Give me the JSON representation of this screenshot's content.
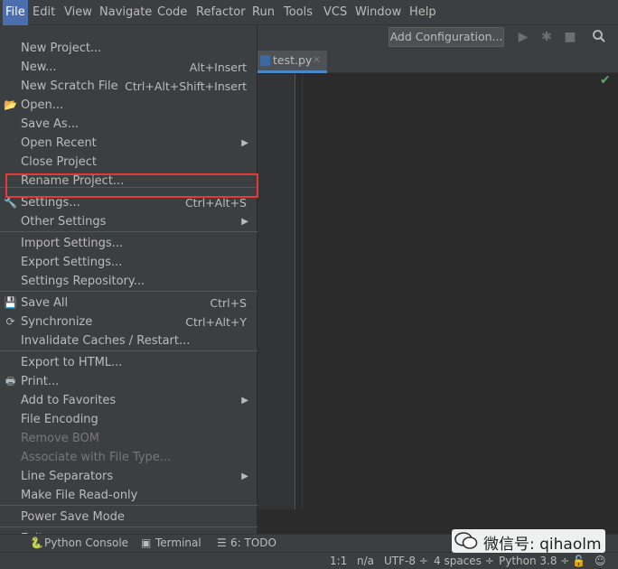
{
  "menubar": {
    "items": [
      "File",
      "Edit",
      "View",
      "Navigate",
      "Code",
      "Refactor",
      "Run",
      "Tools",
      "VCS",
      "Window",
      "Help"
    ],
    "active": "File"
  },
  "toolbar": {
    "add_configuration": "Add Configuration...",
    "icons": [
      "run-icon",
      "debug-icon",
      "stop-icon",
      "search-icon"
    ]
  },
  "editor": {
    "tab_label": "test.py",
    "tab_close": "×",
    "inspection": "check-icon"
  },
  "file_menu": {
    "items": [
      {
        "label": "New Project...",
        "shortcut": "",
        "icon": "",
        "submenu": false,
        "disabled": false
      },
      {
        "label": "New...",
        "shortcut": "Alt+Insert",
        "icon": "",
        "submenu": false,
        "disabled": false
      },
      {
        "label": "New Scratch File",
        "shortcut": "Ctrl+Alt+Shift+Insert",
        "icon": "",
        "submenu": false,
        "disabled": false
      },
      {
        "label": "Open...",
        "shortcut": "",
        "icon": "folder-icon",
        "submenu": false,
        "disabled": false
      },
      {
        "label": "Save As...",
        "shortcut": "",
        "icon": "",
        "submenu": false,
        "disabled": false
      },
      {
        "label": "Open Recent",
        "shortcut": "",
        "icon": "",
        "submenu": true,
        "disabled": false
      },
      {
        "label": "Close Project",
        "shortcut": "",
        "icon": "",
        "submenu": false,
        "disabled": false
      },
      {
        "label": "Rename Project...",
        "shortcut": "",
        "icon": "",
        "submenu": false,
        "disabled": false
      },
      {
        "label": "Settings...",
        "shortcut": "Ctrl+Alt+S",
        "icon": "wrench-icon",
        "submenu": false,
        "disabled": false
      },
      {
        "label": "Other Settings",
        "shortcut": "",
        "icon": "",
        "submenu": true,
        "disabled": false
      },
      {
        "label": "Import Settings...",
        "shortcut": "",
        "icon": "",
        "submenu": false,
        "disabled": false
      },
      {
        "label": "Export Settings...",
        "shortcut": "",
        "icon": "",
        "submenu": false,
        "disabled": false
      },
      {
        "label": "Settings Repository...",
        "shortcut": "",
        "icon": "",
        "submenu": false,
        "disabled": false
      },
      {
        "label": "Save All",
        "shortcut": "Ctrl+S",
        "icon": "save-icon",
        "submenu": false,
        "disabled": false
      },
      {
        "label": "Synchronize",
        "shortcut": "Ctrl+Alt+Y",
        "icon": "refresh-icon",
        "submenu": false,
        "disabled": false
      },
      {
        "label": "Invalidate Caches / Restart...",
        "shortcut": "",
        "icon": "",
        "submenu": false,
        "disabled": false
      },
      {
        "label": "Export to HTML...",
        "shortcut": "",
        "icon": "",
        "submenu": false,
        "disabled": false
      },
      {
        "label": "Print...",
        "shortcut": "",
        "icon": "print-icon",
        "submenu": false,
        "disabled": false
      },
      {
        "label": "Add to Favorites",
        "shortcut": "",
        "icon": "",
        "submenu": true,
        "disabled": false
      },
      {
        "label": "File Encoding",
        "shortcut": "",
        "icon": "",
        "submenu": false,
        "disabled": false
      },
      {
        "label": "Remove BOM",
        "shortcut": "",
        "icon": "",
        "submenu": false,
        "disabled": true
      },
      {
        "label": "Associate with File Type...",
        "shortcut": "",
        "icon": "",
        "submenu": false,
        "disabled": true
      },
      {
        "label": "Line Separators",
        "shortcut": "",
        "icon": "",
        "submenu": true,
        "disabled": false
      },
      {
        "label": "Make File Read-only",
        "shortcut": "",
        "icon": "",
        "submenu": false,
        "disabled": false
      },
      {
        "label": "Power Save Mode",
        "shortcut": "",
        "icon": "",
        "submenu": false,
        "disabled": false
      },
      {
        "label": "Exit",
        "shortcut": "",
        "icon": "",
        "submenu": false,
        "disabled": false
      }
    ]
  },
  "bottom_tools": {
    "python_console": "Python Console",
    "terminal": "Terminal",
    "todo": "6: TODO"
  },
  "status": {
    "position": "1:1",
    "na": "n/a",
    "encoding": "UTF-8 ÷",
    "indent": "4 spaces ÷",
    "interpreter": "Python 3.8 ÷"
  },
  "watermark": {
    "text": "微信号: qihaolm"
  },
  "colors": {
    "menu_bg": "#3c3f41",
    "editor_bg": "#2b2b2b",
    "accent": "#4b6eaf",
    "highlight": "#e53935"
  }
}
